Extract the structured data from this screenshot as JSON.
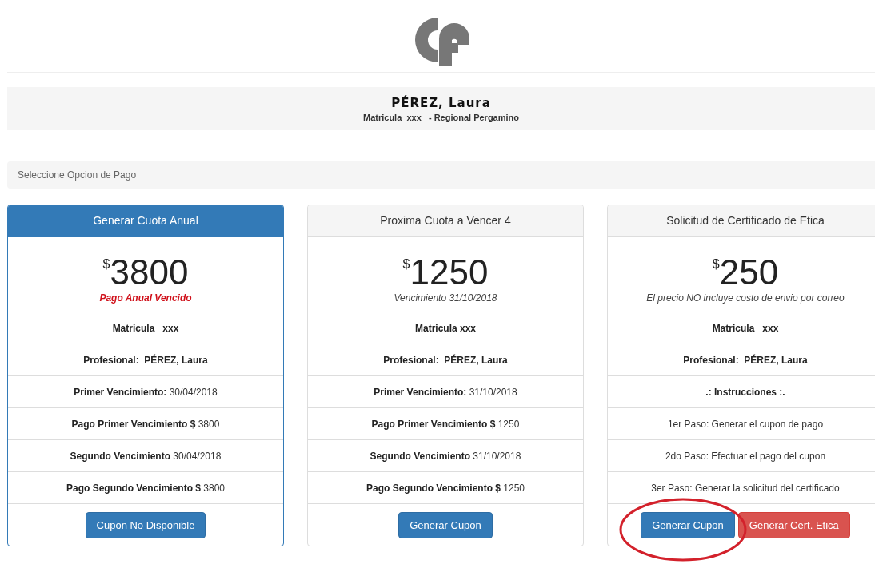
{
  "header": {
    "name": "PÉREZ, Laura",
    "details": "Matricula  xxx   - Regional Pergamino"
  },
  "option_bar": {
    "label": "Seleccione Opcion de Pago"
  },
  "cards": [
    {
      "title": "Generar Cuota Anual",
      "highlighted": true,
      "currency": "$",
      "amount": "3800",
      "subtitle": {
        "text": "Pago Anual Vencido",
        "kind": "alert"
      },
      "rows": [
        "**Matricula**   **xxx**",
        "**Profesional:  PÉREZ, Laura**",
        "**Primer Vencimiento:** 30/04/2018",
        "**Pago Primer Vencimiento $** 3800",
        "**Segundo Vencimiento** 30/04/2018",
        "**Pago Segundo Vencimiento $** 3800"
      ],
      "buttons": [
        {
          "label": "Cupon No Disponible",
          "kind": "primary"
        }
      ]
    },
    {
      "title": "Proxima Cuota a Vencer 4",
      "highlighted": false,
      "currency": "$",
      "amount": "1250",
      "subtitle": {
        "text": "Vencimiento 31/10/2018",
        "kind": "note"
      },
      "rows": [
        "**Matricula xxx**",
        "**Profesional:  PÉREZ, Laura**",
        "**Primer Vencimiento:** 31/10/2018",
        "**Pago Primer Vencimiento $** 1250",
        "**Segundo Vencimiento** 31/10/2018",
        "**Pago Segundo Vencimiento $** 1250"
      ],
      "buttons": [
        {
          "label": "Generar Cupon",
          "kind": "primary"
        }
      ]
    },
    {
      "title": "Solicitud de Certificado de Etica",
      "highlighted": false,
      "currency": "$",
      "amount": "250",
      "subtitle": {
        "text": "El precio NO incluye costo de envio por correo",
        "kind": "note"
      },
      "rows": [
        "**Matricula**   **xxx**",
        "**Profesional:  PÉREZ, Laura**",
        "**.: Instrucciones :.**",
        "1er Paso: Generar el cupon de pago",
        "2do Paso: Efectuar el pago del cupon",
        "3er Paso: Generar la solicitud del certificado"
      ],
      "buttons": [
        {
          "label": "Generar Cupon",
          "kind": "primary"
        },
        {
          "label": "Generar Cert. Etica",
          "kind": "danger"
        }
      ]
    }
  ],
  "annotation": {
    "kind": "ellipse"
  }
}
